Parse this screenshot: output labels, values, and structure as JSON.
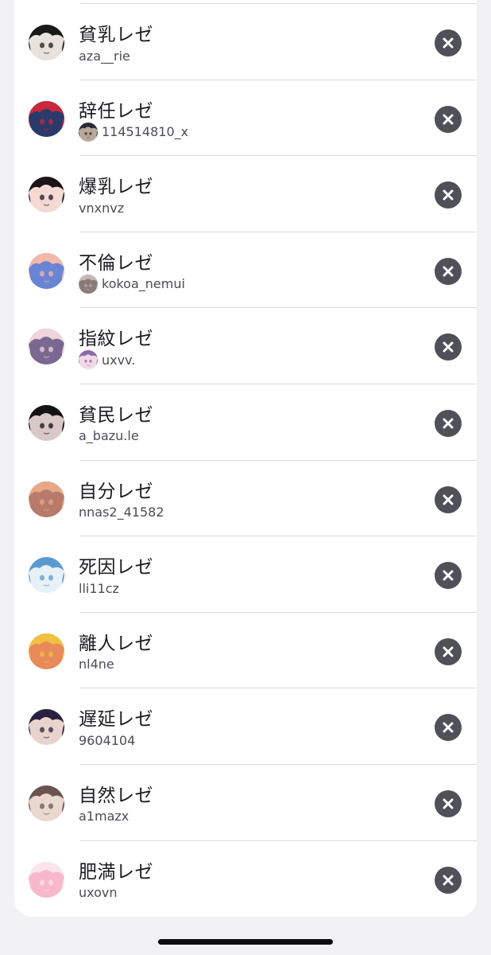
{
  "list": {
    "rows": [
      {
        "name": "貧乳レゼ",
        "username": "aza__rie",
        "has_mini_avatar": false,
        "avatar_colors": [
          "#1a1a1a",
          "#e8e2dc"
        ]
      },
      {
        "name": "辞任レゼ",
        "username": "114514810_x",
        "has_mini_avatar": true,
        "avatar_colors": [
          "#c8283a",
          "#2a3a6a"
        ],
        "mini_colors": [
          "#2a2a30",
          "#b9a79a"
        ]
      },
      {
        "name": "爆乳レゼ",
        "username": "vnxnvz",
        "has_mini_avatar": false,
        "avatar_colors": [
          "#1c1518",
          "#f4d9d4"
        ]
      },
      {
        "name": "不倫レゼ",
        "username": "kokoa_nemui",
        "has_mini_avatar": true,
        "avatar_colors": [
          "#f2b8a8",
          "#6a84d4"
        ],
        "mini_colors": [
          "#c8b8b4",
          "#8a7a7a"
        ]
      },
      {
        "name": "指紋レゼ",
        "username": "uxvv.",
        "has_mini_avatar": true,
        "avatar_colors": [
          "#f0d4dc",
          "#7a6890"
        ],
        "mini_colors": [
          "#8a6aa8",
          "#f0d8e8"
        ]
      },
      {
        "name": "貧民レゼ",
        "username": "a_bazu.le",
        "has_mini_avatar": false,
        "avatar_colors": [
          "#141214",
          "#d8c8c8"
        ]
      },
      {
        "name": "自分レゼ",
        "username": "nnas2_41582",
        "has_mini_avatar": false,
        "avatar_colors": [
          "#e8a888",
          "#b87a6a"
        ]
      },
      {
        "name": "死因レゼ",
        "username": "lli11cz",
        "has_mini_avatar": false,
        "avatar_colors": [
          "#5a9ad0",
          "#e8f0f8"
        ]
      },
      {
        "name": "離人レゼ",
        "username": "nl4ne",
        "has_mini_avatar": false,
        "avatar_colors": [
          "#f0c040",
          "#e88a5a"
        ]
      },
      {
        "name": "遅延レゼ",
        "username": "9604104",
        "has_mini_avatar": false,
        "avatar_colors": [
          "#2a2040",
          "#e8d4cc"
        ]
      },
      {
        "name": "自然レゼ",
        "username": "a1mazx",
        "has_mini_avatar": false,
        "avatar_colors": [
          "#6a5450",
          "#e8d8d0"
        ]
      },
      {
        "name": "肥満レゼ",
        "username": "uxovn",
        "has_mini_avatar": false,
        "avatar_colors": [
          "#fce4ec",
          "#f8b8cc"
        ]
      }
    ]
  },
  "icons": {
    "remove": "close-circle-icon"
  },
  "colors": {
    "remove_button": "#4f5058",
    "divider": "#dcdcde",
    "background": "#f2f2f4"
  }
}
